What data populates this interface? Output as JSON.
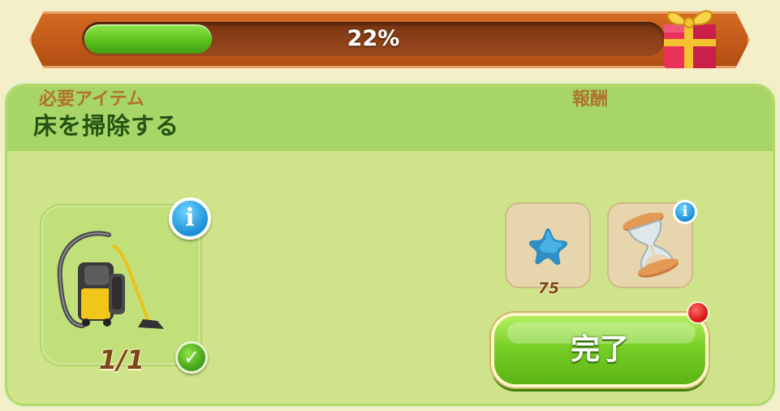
{
  "progress": {
    "percent_text": "22%",
    "value_fraction": 0.22,
    "fill_color": "#5cc21f"
  },
  "task": {
    "title": "床を掃除する"
  },
  "required": {
    "label": "必要アイテム",
    "item_icon": "vacuum-cleaner-icon",
    "count_text": "1/1",
    "completed": true
  },
  "rewards": {
    "label": "報酬",
    "items": [
      {
        "icon": "blue-star-icon",
        "amount": "75"
      },
      {
        "icon": "hourglass-icon",
        "amount": ""
      }
    ]
  },
  "actions": {
    "complete_label": "完了"
  },
  "colors": {
    "header_green": "#a8d567",
    "panel_green": "#cfe48a",
    "title_text": "#235414",
    "label_brown": "#b0742e",
    "button_green": "#79cf27",
    "notification_red": "#d7100e"
  }
}
